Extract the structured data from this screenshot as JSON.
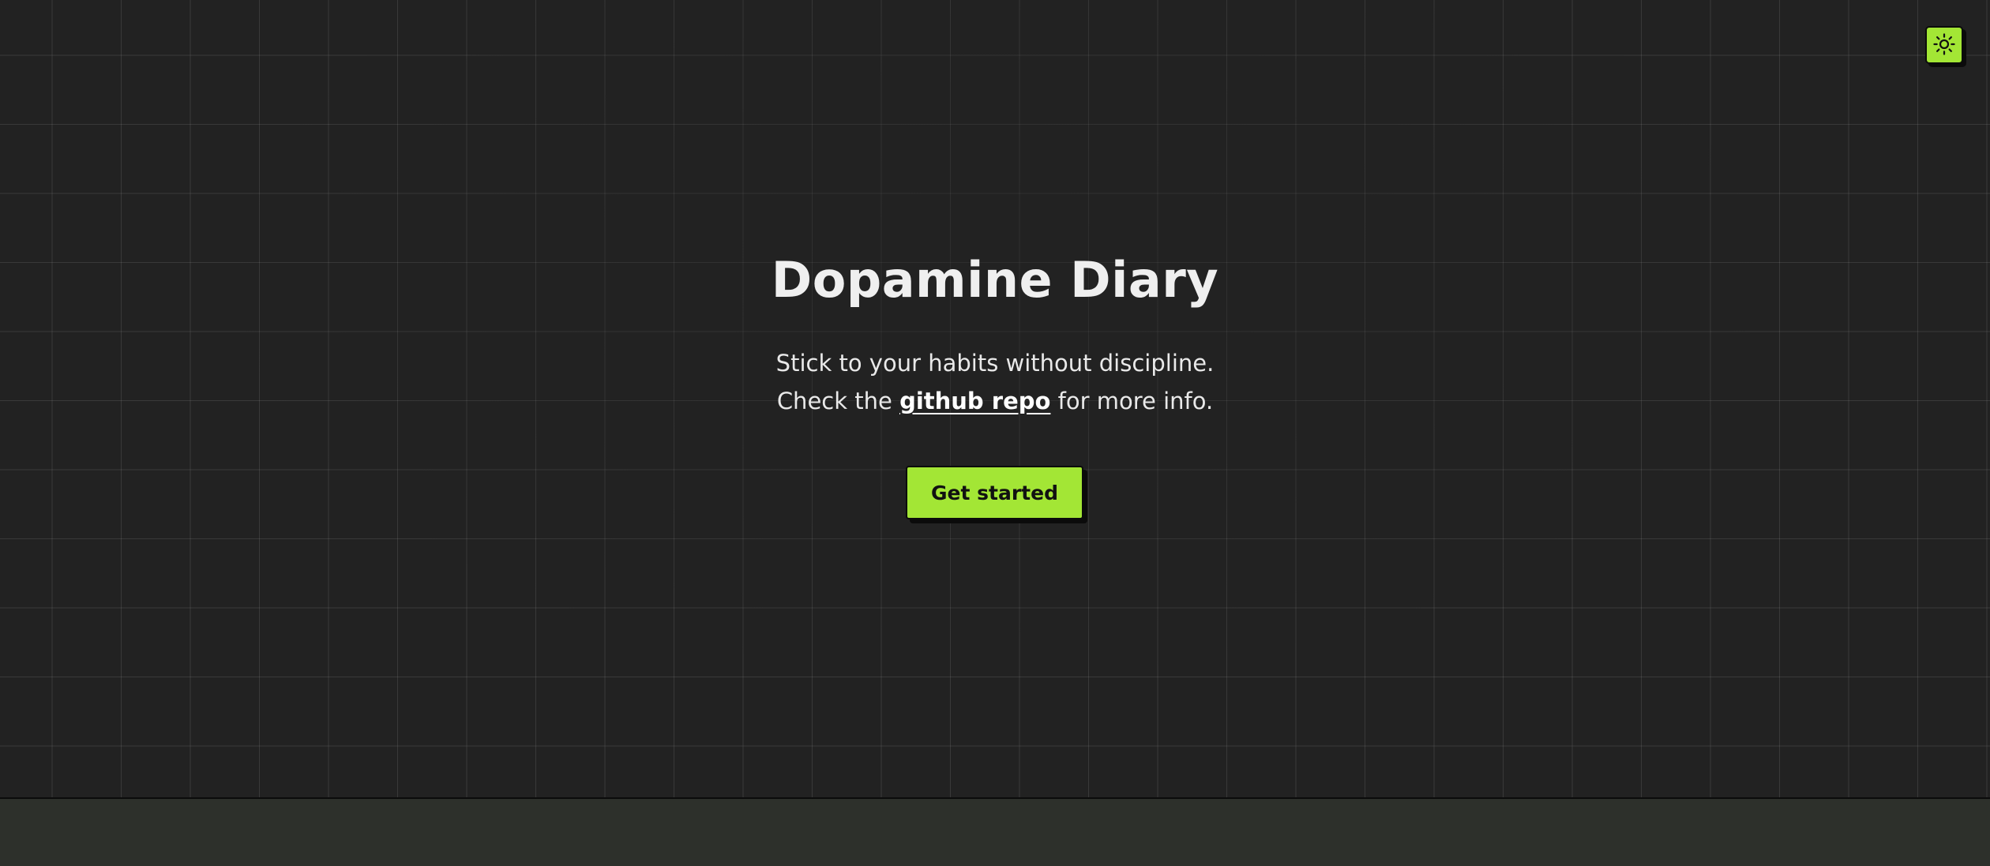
{
  "app": {
    "title": "Dopamine Diary",
    "tagline_line1": "Stick to your habits without discipline.",
    "tagline_prefix": "Check the",
    "link_text": "github repo",
    "tagline_suffix": "for more info.",
    "cta_label": "Get started"
  },
  "theme_toggle": {
    "icon": "sun-icon"
  },
  "colors": {
    "background": "#222222",
    "accent": "#a3e635",
    "footer": "#2d302b",
    "text": "#ececec"
  }
}
